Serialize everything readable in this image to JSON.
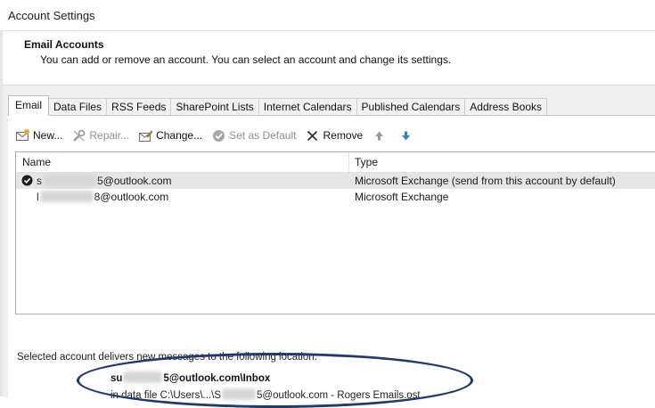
{
  "window": {
    "title": "Account Settings"
  },
  "header": {
    "section_title": "Email Accounts",
    "description": "You can add or remove an account. You can select an account and change its settings."
  },
  "tabs": [
    {
      "label": "Email",
      "active": true
    },
    {
      "label": "Data Files"
    },
    {
      "label": "RSS Feeds"
    },
    {
      "label": "SharePoint Lists"
    },
    {
      "label": "Internet Calendars"
    },
    {
      "label": "Published Calendars"
    },
    {
      "label": "Address Books"
    }
  ],
  "toolbar": {
    "new_label": "New...",
    "repair_label": "Repair...",
    "change_label": "Change...",
    "set_default_label": "Set as Default",
    "remove_label": "Remove"
  },
  "accounts_list": {
    "columns": {
      "name": "Name",
      "type": "Type"
    },
    "rows": [
      {
        "name_prefix": "s",
        "name_suffix": "5@outlook.com",
        "type": "Microsoft Exchange (send from this account by default)",
        "default": true,
        "selected": true
      },
      {
        "name_prefix": "l",
        "name_suffix": "8@outlook.com",
        "type": "Microsoft Exchange",
        "default": false,
        "selected": false
      }
    ]
  },
  "delivery": {
    "label": "Selected account delivers new messages to the following location:",
    "inbox_prefix": "su",
    "inbox_suffix": "5@outlook.com\\Inbox",
    "datafile_prefix": "in data file C:\\Users\\...\\S",
    "datafile_suffix": "5@outlook.com - Rogers Emails.ost"
  },
  "colors": {
    "annotation_circle": "#1f3a70",
    "selected_row": "#e5e5e5",
    "arrow_blue": "#3b7bd8"
  }
}
